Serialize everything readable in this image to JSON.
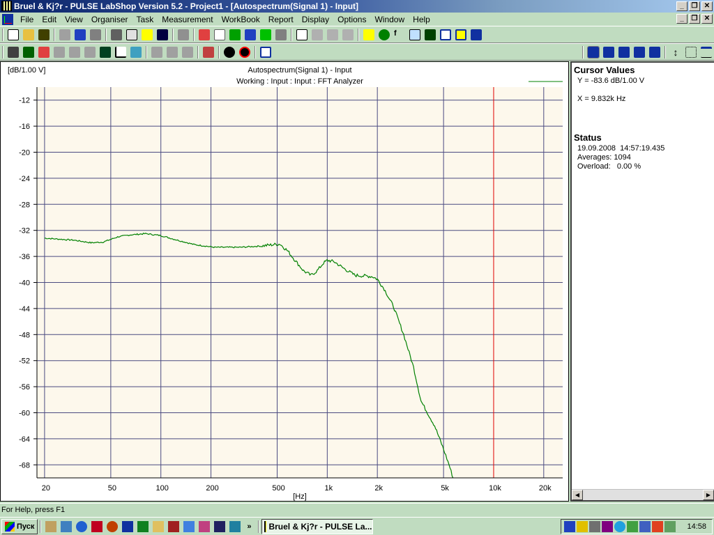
{
  "window": {
    "title": "Bruel & Kj?r - PULSE LabShop Version 5.2 - Project1 - [Autospectrum(Signal 1) - Input]",
    "minimize": "_",
    "restore": "❐",
    "close": "✕"
  },
  "menu": [
    "File",
    "Edit",
    "View",
    "Organiser",
    "Task",
    "Measurement",
    "WorkBook",
    "Report",
    "Display",
    "Options",
    "Window",
    "Help"
  ],
  "chart_data": {
    "type": "line",
    "title": "Autospectrum(Signal 1) - Input",
    "subtitle": "Working : Input : Input : FFT Analyzer",
    "ylabel": "[dB/1.00 V]",
    "xlabel": "[Hz]",
    "xscale": "log",
    "xlim": [
      18,
      26000
    ],
    "ylim": [
      -70,
      -10
    ],
    "yticks": [
      -12,
      -16,
      -20,
      -24,
      -28,
      -32,
      -36,
      -40,
      -44,
      -48,
      -52,
      -56,
      -60,
      -64,
      -68
    ],
    "xticks": [
      {
        "v": 20,
        "l": "20"
      },
      {
        "v": 50,
        "l": "50"
      },
      {
        "v": 100,
        "l": "100"
      },
      {
        "v": 200,
        "l": "200"
      },
      {
        "v": 500,
        "l": "500"
      },
      {
        "v": 1000,
        "l": "1k"
      },
      {
        "v": 2000,
        "l": "2k"
      },
      {
        "v": 5000,
        "l": "5k"
      },
      {
        "v": 10000,
        "l": "10k"
      },
      {
        "v": 20000,
        "l": "20k"
      }
    ],
    "cursor_x": 10000,
    "grid": true,
    "series": [
      {
        "name": "Autospectrum(Signal 1)",
        "color": "#008000",
        "x": [
          20,
          30,
          38,
          45,
          55,
          65,
          81,
          100,
          130,
          160,
          211,
          300,
          400,
          470,
          520,
          580,
          650,
          720,
          798,
          870,
          950,
          1000,
          1100,
          1250,
          1470,
          1700,
          1870,
          2000,
          2200,
          2500,
          2880,
          3300,
          3660,
          4000,
          4420,
          5000,
          5400,
          5700
        ],
        "y": [
          -33.2,
          -33.5,
          -33.9,
          -33.8,
          -33.0,
          -32.7,
          -32.5,
          -32.8,
          -33.6,
          -34.2,
          -34.6,
          -34.6,
          -34.4,
          -34.2,
          -34.1,
          -35.2,
          -36.8,
          -38.2,
          -38.9,
          -38.2,
          -37.0,
          -36.6,
          -36.8,
          -37.8,
          -38.9,
          -39.0,
          -39.1,
          -39.5,
          -41.0,
          -43.7,
          -48.0,
          -53.0,
          -58.2,
          -60.0,
          -62.0,
          -65.6,
          -68.0,
          -70.0
        ]
      }
    ]
  },
  "cursor_values": {
    "heading": "Cursor Values",
    "y": "Y = -83.6 dB/1.00 V",
    "x": "X = 9.832k Hz"
  },
  "status": {
    "heading": "Status",
    "datetime": "19.09.2008  14:57:19.435",
    "averages": "Averages: 1094",
    "overload": "Overload:   0.00 %"
  },
  "statusbar": "For Help, press F1",
  "taskbar": {
    "start": "Пуск",
    "task": "Bruel & Kj?r - PULSE La...",
    "clock": "14:58",
    "chevron": "»"
  }
}
